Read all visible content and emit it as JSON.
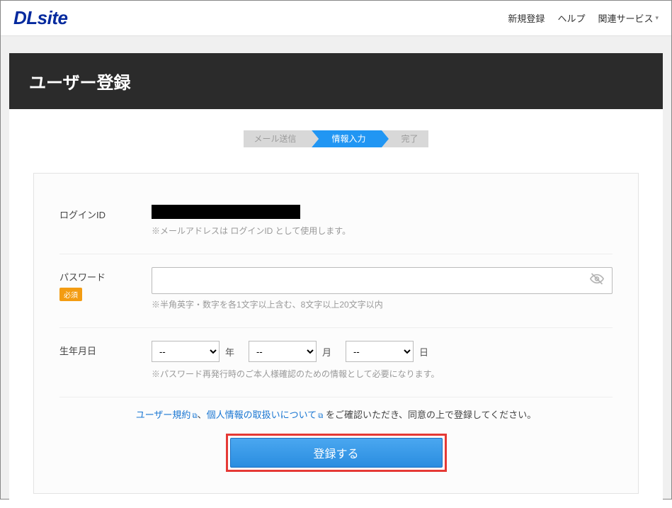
{
  "header": {
    "logo": "DLsite",
    "links": {
      "register": "新規登録",
      "help": "ヘルプ",
      "related": "関連サービス"
    }
  },
  "page": {
    "title": "ユーザー登録"
  },
  "steps": {
    "step1": "メール送信",
    "step2": "情報入力",
    "step3": "完了"
  },
  "form": {
    "login_id": {
      "label": "ログインID",
      "hint": "※メールアドレスは ログインID として使用します。"
    },
    "password": {
      "label": "パスワード",
      "required": "必須",
      "value": "",
      "hint": "※半角英字・数字を各1文字以上含む、8文字以上20文字以内"
    },
    "birthdate": {
      "label": "生年月日",
      "year_placeholder": "--",
      "month_placeholder": "--",
      "day_placeholder": "--",
      "year_unit": "年",
      "month_unit": "月",
      "day_unit": "日",
      "hint": "※パスワード再発行時のご本人様確認のための情報として必要になります。"
    }
  },
  "agreement": {
    "terms_link": "ユーザー規約",
    "separator": "、",
    "privacy_link": "個人情報の取扱いについて",
    "tail": " をご確認いただき、同意の上で登録してください。"
  },
  "submit": {
    "label": "登録する"
  }
}
